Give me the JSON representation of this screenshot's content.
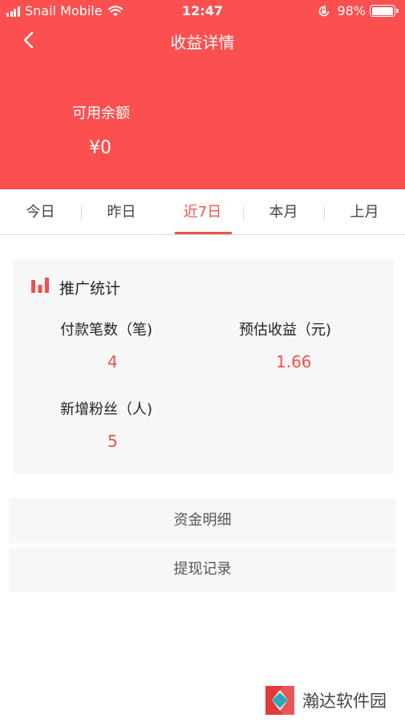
{
  "status_bar": {
    "carrier": "Snail Mobile",
    "time": "12:47",
    "battery_percent": "98%",
    "battery_level": 0.98
  },
  "nav": {
    "title": "收益详情",
    "back_icon": "chevron-left-icon"
  },
  "balance": {
    "label": "可用余额",
    "value": "¥0"
  },
  "tabs": [
    {
      "label": "今日",
      "active": false
    },
    {
      "label": "昨日",
      "active": false
    },
    {
      "label": "近7日",
      "active": true
    },
    {
      "label": "本月",
      "active": false
    },
    {
      "label": "上月",
      "active": false
    }
  ],
  "stats": {
    "title": "推广统计",
    "icon": "bar-chart-icon",
    "items": [
      {
        "label": "付款笔数（笔)",
        "value": "4"
      },
      {
        "label": "预估收益（元)",
        "value": "1.66"
      },
      {
        "label": "新增粉丝（人)",
        "value": "5"
      }
    ]
  },
  "menu": {
    "funds_detail": "资金明细",
    "withdraw_records": "提现记录"
  },
  "watermark": {
    "text": "瀚达软件园"
  },
  "colors": {
    "accent": "#fc5050",
    "highlight": "#f0524b",
    "card_bg": "#f7f7f7"
  }
}
